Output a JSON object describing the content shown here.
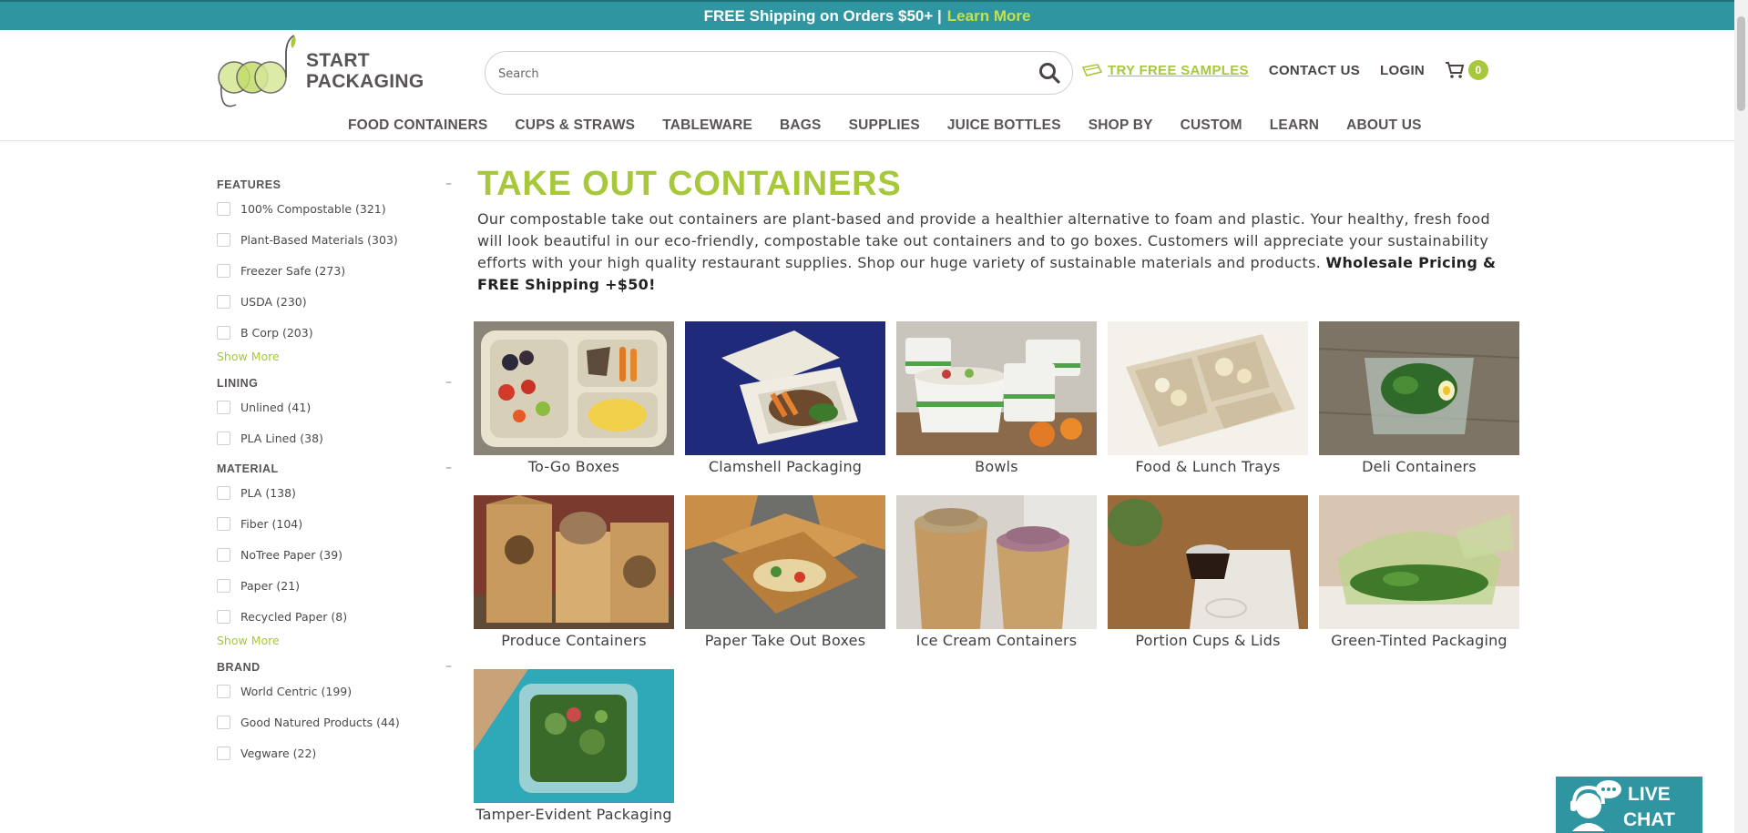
{
  "promo": {
    "text": "FREE Shipping on Orders $50+ |",
    "link": "Learn More"
  },
  "brand": {
    "line1": "START",
    "line2": "PACKAGING"
  },
  "search": {
    "placeholder": "Search"
  },
  "util_nav": {
    "samples": "TRY FREE SAMPLES",
    "contact": "CONTACT US",
    "login": "LOGIN",
    "cart_count": "0"
  },
  "main_nav": [
    "FOOD CONTAINERS",
    "CUPS & STRAWS",
    "TABLEWARE",
    "BAGS",
    "SUPPLIES",
    "JUICE BOTTLES",
    "SHOP BY",
    "CUSTOM",
    "LEARN",
    "ABOUT US"
  ],
  "filters": {
    "features": {
      "title": "FEATURES",
      "options": [
        "100% Compostable (321)",
        "Plant-Based Materials (303)",
        "Freezer Safe (273)",
        "USDA (230)",
        "B Corp (203)"
      ],
      "show_more": "Show More"
    },
    "lining": {
      "title": "LINING",
      "options": [
        "Unlined (41)",
        "PLA Lined (38)"
      ]
    },
    "material": {
      "title": "MATERIAL",
      "options": [
        "PLA (138)",
        "Fiber (104)",
        "NoTree Paper (39)",
        "Paper (21)",
        "Recycled Paper (8)"
      ],
      "show_more": "Show More"
    },
    "brand": {
      "title": "BRAND",
      "options": [
        "World Centric (199)",
        "Good Natured Products (44)",
        "Vegware (22)"
      ]
    }
  },
  "page": {
    "title": "TAKE OUT CONTAINERS",
    "intro": "Our compostable take out containers are plant-based and provide a healthier alternative to foam and plastic. Your healthy, fresh food will look beautiful in our eco-friendly, compostable take out containers and to go boxes. Customers will appreciate your sustainability efforts with your high quality restaurant supplies. Shop our huge variety of sustainable materials and products.",
    "intro_bold": "Wholesale Pricing & FREE Shipping +$50!"
  },
  "categories": [
    "To-Go Boxes",
    "Clamshell Packaging",
    "Bowls",
    "Food & Lunch Trays",
    "Deli Containers",
    "Produce Containers",
    "Paper Take Out Boxes",
    "Ice Cream Containers",
    "Portion Cups & Lids",
    "Green-Tinted Packaging",
    "Tamper-Evident Packaging"
  ],
  "live_chat": {
    "line1": "LIVE",
    "line2": "CHAT"
  },
  "colors": {
    "accent_green": "#a7c83a",
    "teal": "#2f95a1",
    "text_dark": "#5a5354"
  }
}
